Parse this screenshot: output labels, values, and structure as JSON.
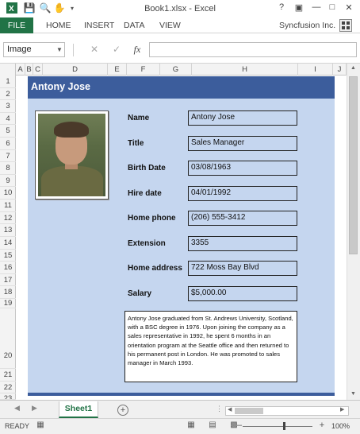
{
  "window": {
    "title": "Book1.xlsx - Excel",
    "help_label": "?",
    "min_label": "—",
    "max_label": "□",
    "close_label": "✕"
  },
  "ribbon": {
    "tabs": [
      "FILE",
      "HOME",
      "INSERT",
      "DATA",
      "VIEW"
    ],
    "account": "Syncfusion Inc."
  },
  "formula_bar": {
    "name_box": "Image",
    "cancel_glyph": "✕",
    "enter_glyph": "✓",
    "fx_glyph": "fx",
    "formula_value": ""
  },
  "columns": [
    "A",
    "B",
    "C",
    "D",
    "E",
    "F",
    "G",
    "H",
    "I",
    "J"
  ],
  "rows": [
    "1",
    "2",
    "3",
    "4",
    "5",
    "6",
    "7",
    "8",
    "9",
    "10",
    "11",
    "12",
    "13",
    "14",
    "15",
    "16",
    "17",
    "18",
    "19",
    "20",
    "21",
    "22",
    "23"
  ],
  "employee": {
    "name": "Antony Jose",
    "fields": [
      {
        "label": "Name",
        "value": "Antony Jose"
      },
      {
        "label": "Title",
        "value": "Sales Manager"
      },
      {
        "label": "Birth Date",
        "value": "03/08/1963"
      },
      {
        "label": "Hire date",
        "value": "04/01/1992"
      },
      {
        "label": "Home phone",
        "value": "(206) 555-3412"
      },
      {
        "label": "Extension",
        "value": "3355"
      },
      {
        "label": "Home address",
        "value": "722 Moss Bay Blvd"
      },
      {
        "label": "Salary",
        "value": "$5,000.00"
      }
    ],
    "bio": "Antony Jose graduated from St. Andrews University, Scotland, with a BSC degree in 1976.  Upon joining the company as a sales representative in 1992, he spent 6 months in an orientation program at the Seattle office and then returned to his permanent post in London.  He was promoted to sales manager in March 1993."
  },
  "sheet_tabs": {
    "active": "Sheet1",
    "add_label": "⊕"
  },
  "status": {
    "ready": "READY",
    "zoom": "100%"
  },
  "colors": {
    "excel_green": "#217346",
    "band_blue": "#3c5d9c",
    "card_blue": "#c5d6ef"
  }
}
